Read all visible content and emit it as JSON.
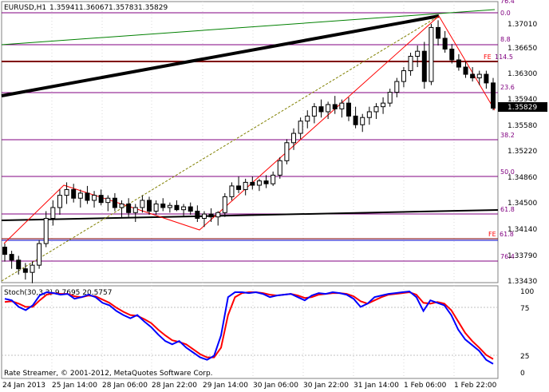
{
  "header": {
    "symbol": "EURUSD,H1",
    "open": "1.35941",
    "high": "1.36067",
    "low": "1.35783",
    "close": "1.35829"
  },
  "indicator": {
    "label": "Stoch(30,3,3) 9.7695 20.5757",
    "levels": [
      "100",
      "75",
      "25",
      "0"
    ]
  },
  "footer": {
    "copyright": "Rate Streamer, © 2001-2012, MetaQuotes Software Corp."
  },
  "current_price": "1.35829",
  "colors": {
    "background": "#ffffff",
    "grid": "#c0c0c0",
    "fibonacci": "#800080",
    "fibonacci_expansion": "#ff0000",
    "trendline_thick": "#000000",
    "trendline_green": "#008000",
    "stoch_main": "#0000ff",
    "stoch_signal": "#ff0000"
  },
  "fib_levels": [
    "0.0",
    "8.8",
    "23.6",
    "38.2",
    "50.0",
    "61.8",
    "76.4"
  ],
  "fe_levels": [
    {
      "label": "FE",
      "value": "114.5"
    },
    {
      "label": "FE",
      "value": "61.8"
    }
  ],
  "chart_data": {
    "type": "candlestick",
    "price_ticks": [
      "1.37010",
      "1.36650",
      "1.36300",
      "1.35940",
      "1.35580",
      "1.35220",
      "1.34860",
      "1.34500",
      "1.34140",
      "1.33790",
      "1.33430"
    ],
    "time_ticks": [
      "24 Jan 2013",
      "25 Jan 14:00",
      "28 Jan 06:00",
      "28 Jan 22:00",
      "29 Jan 14:00",
      "30 Jan 06:00",
      "30 Jan 22:00",
      "31 Jan 14:00",
      "1 Feb 06:00",
      "1 Feb 22:00"
    ],
    "ohlc": [
      [
        1.339,
        1.3395,
        1.337,
        1.338
      ],
      [
        1.338,
        1.3385,
        1.336,
        1.3372
      ],
      [
        1.3372,
        1.3378,
        1.3352,
        1.336
      ],
      [
        1.336,
        1.3368,
        1.3345,
        1.3355
      ],
      [
        1.3355,
        1.337,
        1.334,
        1.3365
      ],
      [
        1.3365,
        1.34,
        1.336,
        1.3395
      ],
      [
        1.3395,
        1.344,
        1.339,
        1.343
      ],
      [
        1.343,
        1.3455,
        1.342,
        1.3445
      ],
      [
        1.3445,
        1.347,
        1.3435,
        1.3462
      ],
      [
        1.3462,
        1.348,
        1.345,
        1.347
      ],
      [
        1.347,
        1.3478,
        1.3452,
        1.3458
      ],
      [
        1.3458,
        1.347,
        1.3445,
        1.3465
      ],
      [
        1.3465,
        1.3475,
        1.345,
        1.3455
      ],
      [
        1.3455,
        1.3468,
        1.3445,
        1.3462
      ],
      [
        1.3462,
        1.347,
        1.3448,
        1.3452
      ],
      [
        1.3452,
        1.3462,
        1.344,
        1.3458
      ],
      [
        1.3458,
        1.3465,
        1.344,
        1.3445
      ],
      [
        1.3445,
        1.3455,
        1.343,
        1.345
      ],
      [
        1.345,
        1.3458,
        1.3432,
        1.3438
      ],
      [
        1.3438,
        1.345,
        1.3425,
        1.3445
      ],
      [
        1.3445,
        1.3462,
        1.3438,
        1.3455
      ],
      [
        1.3455,
        1.346,
        1.3435,
        1.344
      ],
      [
        1.344,
        1.3455,
        1.3435,
        1.345
      ],
      [
        1.345,
        1.3458,
        1.344,
        1.3445
      ],
      [
        1.3445,
        1.3452,
        1.3438,
        1.3448
      ],
      [
        1.3448,
        1.3455,
        1.344,
        1.3442
      ],
      [
        1.3442,
        1.345,
        1.3432,
        1.3446
      ],
      [
        1.3446,
        1.3452,
        1.3435,
        1.344
      ],
      [
        1.344,
        1.3448,
        1.3425,
        1.343
      ],
      [
        1.343,
        1.344,
        1.3418,
        1.3436
      ],
      [
        1.3436,
        1.3444,
        1.3425,
        1.3432
      ],
      [
        1.3432,
        1.344,
        1.342,
        1.3438
      ],
      [
        1.3438,
        1.3465,
        1.3432,
        1.346
      ],
      [
        1.346,
        1.348,
        1.3455,
        1.3475
      ],
      [
        1.3475,
        1.3488,
        1.3465,
        1.347
      ],
      [
        1.347,
        1.3485,
        1.3462,
        1.348
      ],
      [
        1.348,
        1.3488,
        1.347,
        1.3476
      ],
      [
        1.3476,
        1.3485,
        1.3468,
        1.3482
      ],
      [
        1.3482,
        1.349,
        1.3472,
        1.3478
      ],
      [
        1.3478,
        1.3495,
        1.3475,
        1.349
      ],
      [
        1.349,
        1.3515,
        1.3485,
        1.351
      ],
      [
        1.351,
        1.354,
        1.3505,
        1.3535
      ],
      [
        1.3535,
        1.3555,
        1.3525,
        1.3548
      ],
      [
        1.3548,
        1.357,
        1.354,
        1.3565
      ],
      [
        1.3565,
        1.358,
        1.3555,
        1.3572
      ],
      [
        1.3572,
        1.359,
        1.3562,
        1.3585
      ],
      [
        1.3585,
        1.3595,
        1.357,
        1.3578
      ],
      [
        1.3578,
        1.3592,
        1.3568,
        1.3588
      ],
      [
        1.3588,
        1.36,
        1.3575,
        1.3582
      ],
      [
        1.3582,
        1.3595,
        1.357,
        1.359
      ],
      [
        1.359,
        1.3598,
        1.3565,
        1.3572
      ],
      [
        1.3572,
        1.3585,
        1.3555,
        1.356
      ],
      [
        1.356,
        1.3575,
        1.355,
        1.357
      ],
      [
        1.357,
        1.3585,
        1.356,
        1.3578
      ],
      [
        1.3578,
        1.359,
        1.3568,
        1.3585
      ],
      [
        1.3585,
        1.3598,
        1.3575,
        1.359
      ],
      [
        1.359,
        1.361,
        1.3585,
        1.3605
      ],
      [
        1.3605,
        1.3625,
        1.3598,
        1.362
      ],
      [
        1.362,
        1.364,
        1.3612,
        1.3635
      ],
      [
        1.3635,
        1.366,
        1.3628,
        1.3655
      ],
      [
        1.3655,
        1.367,
        1.364,
        1.3662
      ],
      [
        1.3662,
        1.3675,
        1.361,
        1.362
      ],
      [
        1.362,
        1.37,
        1.3615,
        1.3695
      ],
      [
        1.3695,
        1.3705,
        1.367,
        1.368
      ],
      [
        1.368,
        1.369,
        1.366,
        1.3665
      ],
      [
        1.3665,
        1.3672,
        1.3645,
        1.365
      ],
      [
        1.365,
        1.3658,
        1.3635,
        1.364
      ],
      [
        1.364,
        1.3648,
        1.3625,
        1.363
      ],
      [
        1.363,
        1.364,
        1.362,
        1.3625
      ],
      [
        1.3625,
        1.3635,
        1.3615,
        1.363
      ],
      [
        1.363,
        1.3635,
        1.361,
        1.3618
      ],
      [
        1.3618,
        1.3625,
        1.358,
        1.3583
      ]
    ],
    "stoch_main": [
      90,
      88,
      80,
      76,
      82,
      94,
      98,
      97,
      95,
      96,
      90,
      92,
      95,
      92,
      85,
      82,
      75,
      70,
      66,
      70,
      62,
      55,
      46,
      38,
      34,
      38,
      30,
      24,
      18,
      15,
      20,
      45,
      92,
      98,
      98,
      97,
      98,
      96,
      92,
      94,
      95,
      96,
      92,
      88,
      94,
      97,
      96,
      98,
      97,
      95,
      90,
      80,
      84,
      92,
      94,
      96,
      97,
      98,
      99,
      92,
      75,
      88,
      85,
      82,
      70,
      52,
      40,
      33,
      26,
      15,
      10
    ],
    "stoch_signal": [
      86,
      87,
      84,
      80,
      80,
      88,
      95,
      97,
      96,
      96,
      93,
      92,
      94,
      93,
      89,
      85,
      79,
      74,
      70,
      69,
      65,
      60,
      52,
      45,
      39,
      37,
      34,
      28,
      22,
      18,
      18,
      30,
      70,
      92,
      97,
      98,
      98,
      97,
      95,
      94,
      95,
      96,
      94,
      91,
      92,
      95,
      96,
      97,
      97,
      96,
      93,
      87,
      84,
      88,
      92,
      95,
      96,
      97,
      98,
      95,
      85,
      84,
      86,
      84,
      76,
      62,
      48,
      38,
      30,
      21,
      16
    ]
  }
}
